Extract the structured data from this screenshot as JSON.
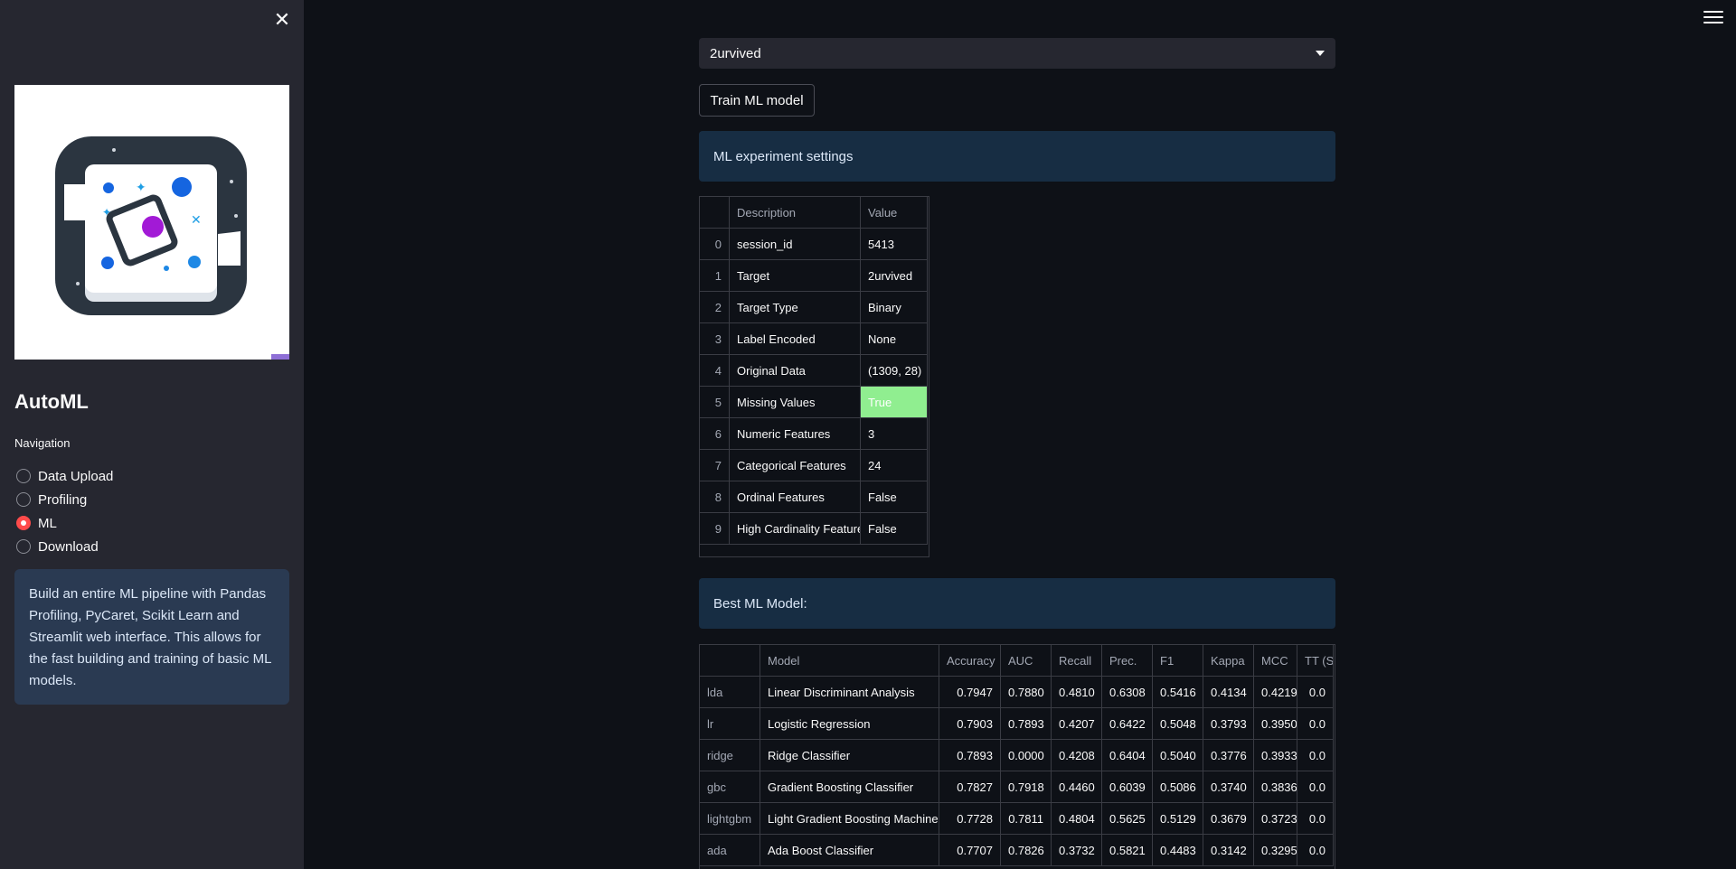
{
  "sidebar": {
    "close_icon": "close-icon",
    "logo_icon": "automl-logo",
    "title": "AutoML",
    "nav_label": "Navigation",
    "nav_items": [
      {
        "label": "Data Upload",
        "selected": false
      },
      {
        "label": "Profiling",
        "selected": false
      },
      {
        "label": "ML",
        "selected": true
      },
      {
        "label": "Download",
        "selected": false
      }
    ],
    "info_text": "Build an entire ML pipeline with Pandas Profiling, PyCaret, Scikit Learn and Streamlit web interface. This allows for the fast building and training of basic ML models."
  },
  "main": {
    "menu_icon": "hamburger-menu-icon",
    "target_select": {
      "value": "2urvived"
    },
    "train_button": "Train ML model",
    "settings_banner": "ML experiment settings",
    "settings_table": {
      "headers": [
        "",
        "Description",
        "Value"
      ],
      "rows": [
        [
          "0",
          "session_id",
          "5413"
        ],
        [
          "1",
          "Target",
          "2urvived"
        ],
        [
          "2",
          "Target Type",
          "Binary"
        ],
        [
          "3",
          "Label Encoded",
          "None"
        ],
        [
          "4",
          "Original Data",
          "(1309, 28)"
        ],
        [
          "5",
          "Missing Values",
          "True"
        ],
        [
          "6",
          "Numeric Features",
          "3"
        ],
        [
          "7",
          "Categorical Features",
          "24"
        ],
        [
          "8",
          "Ordinal Features",
          "False"
        ],
        [
          "9",
          "High Cardinality Features",
          "False"
        ]
      ],
      "highlight_color": "#90ee90"
    },
    "best_banner": "Best ML Model:",
    "models_table": {
      "headers": [
        "",
        "Model",
        "Accuracy",
        "AUC",
        "Recall",
        "Prec.",
        "F1",
        "Kappa",
        "MCC",
        "TT (Sec)"
      ],
      "rows": [
        [
          "lda",
          "Linear Discriminant Analysis",
          "0.7947",
          "0.7880",
          "0.4810",
          "0.6308",
          "0.5416",
          "0.4134",
          "0.4219",
          "0.0"
        ],
        [
          "lr",
          "Logistic Regression",
          "0.7903",
          "0.7893",
          "0.4207",
          "0.6422",
          "0.5048",
          "0.3793",
          "0.3950",
          "0.0"
        ],
        [
          "ridge",
          "Ridge Classifier",
          "0.7893",
          "0.0000",
          "0.4208",
          "0.6404",
          "0.5040",
          "0.3776",
          "0.3933",
          "0.0"
        ],
        [
          "gbc",
          "Gradient Boosting Classifier",
          "0.7827",
          "0.7918",
          "0.4460",
          "0.6039",
          "0.5086",
          "0.3740",
          "0.3836",
          "0.0"
        ],
        [
          "lightgbm",
          "Light Gradient Boosting Machine",
          "0.7728",
          "0.7811",
          "0.4804",
          "0.5625",
          "0.5129",
          "0.3679",
          "0.3723",
          "0.0"
        ],
        [
          "ada",
          "Ada Boost Classifier",
          "0.7707",
          "0.7826",
          "0.3732",
          "0.5821",
          "0.4483",
          "0.3142",
          "0.3295",
          "0.0"
        ]
      ]
    }
  }
}
